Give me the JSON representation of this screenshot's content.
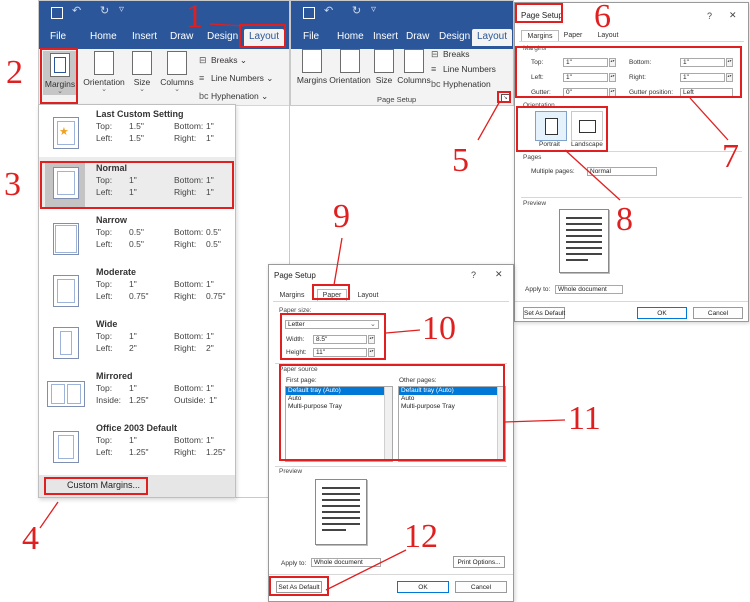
{
  "word_left": {
    "tabs": [
      "File",
      "Home",
      "Insert",
      "Draw",
      "Design",
      "Layout"
    ],
    "buttons": {
      "margins": "Margins",
      "orientation": "Orientation",
      "size": "Size",
      "columns": "Columns"
    },
    "small": {
      "breaks": "Breaks",
      "line_numbers": "Line Numbers",
      "hyphenation": "Hyphenation"
    }
  },
  "margins_menu": {
    "items": [
      {
        "name": "Last Custom Setting",
        "r1": [
          "Top:",
          "1.5\"",
          "Bottom:",
          "1\""
        ],
        "r2": [
          "Left:",
          "1.5\"",
          "Right:",
          "1\""
        ]
      },
      {
        "name": "Normal",
        "r1": [
          "Top:",
          "1\"",
          "Bottom:",
          "1\""
        ],
        "r2": [
          "Left:",
          "1\"",
          "Right:",
          "1\""
        ]
      },
      {
        "name": "Narrow",
        "r1": [
          "Top:",
          "0.5\"",
          "Bottom:",
          "0.5\""
        ],
        "r2": [
          "Left:",
          "0.5\"",
          "Right:",
          "0.5\""
        ]
      },
      {
        "name": "Moderate",
        "r1": [
          "Top:",
          "1\"",
          "Bottom:",
          "1\""
        ],
        "r2": [
          "Left:",
          "0.75\"",
          "Right:",
          "0.75\""
        ]
      },
      {
        "name": "Wide",
        "r1": [
          "Top:",
          "1\"",
          "Bottom:",
          "1\""
        ],
        "r2": [
          "Left:",
          "2\"",
          "Right:",
          "2\""
        ]
      },
      {
        "name": "Mirrored",
        "r1": [
          "Top:",
          "1\"",
          "Bottom:",
          "1\""
        ],
        "r2": [
          "Inside:",
          "1.25\"",
          "Outside:",
          "1\""
        ]
      },
      {
        "name": "Office 2003 Default",
        "r1": [
          "Top:",
          "1\"",
          "Bottom:",
          "1\""
        ],
        "r2": [
          "Left:",
          "1.25\"",
          "Right:",
          "1.25\""
        ]
      }
    ],
    "custom": "Custom Margins..."
  },
  "word_right": {
    "tabs": [
      "File",
      "Home",
      "Insert",
      "Draw",
      "Design",
      "Layout"
    ],
    "buttons": {
      "margins": "Margins",
      "orientation": "Orientation",
      "size": "Size",
      "columns": "Columns"
    },
    "small": {
      "breaks": "Breaks",
      "line_numbers": "Line Numbers",
      "hyphenation": "Hyphenation"
    },
    "group_label": "Page Setup"
  },
  "dialog_margins": {
    "title": "Page Setup",
    "help": "?",
    "close": "✕",
    "tabs": [
      "Margins",
      "Paper",
      "Layout"
    ],
    "section_margins": "Margins",
    "fields": {
      "top": {
        "label": "Top:",
        "value": "1\""
      },
      "bottom": {
        "label": "Bottom:",
        "value": "1\""
      },
      "left": {
        "label": "Left:",
        "value": "1\""
      },
      "right": {
        "label": "Right:",
        "value": "1\""
      },
      "gutter": {
        "label": "Gutter:",
        "value": "0\""
      },
      "gutter_pos": {
        "label": "Gutter position:",
        "value": "Left"
      }
    },
    "section_orientation": "Orientation",
    "portrait": "Portrait",
    "landscape": "Landscape",
    "section_pages": "Pages",
    "multiple_pages": {
      "label": "Multiple pages:",
      "value": "Normal"
    },
    "section_preview": "Preview",
    "apply_to": {
      "label": "Apply to:",
      "value": "Whole document"
    },
    "set_default": "Set As Default",
    "ok": "OK",
    "cancel": "Cancel"
  },
  "dialog_paper": {
    "title": "Page Setup",
    "help": "?",
    "close": "✕",
    "tabs": [
      "Margins",
      "Paper",
      "Layout"
    ],
    "section_size": "Paper size:",
    "size_value": "Letter",
    "width": {
      "label": "Width:",
      "value": "8.5\""
    },
    "height": {
      "label": "Height:",
      "value": "11\""
    },
    "section_source": "Paper source",
    "first_page": {
      "label": "First page:",
      "options": [
        "Default tray (Auto)",
        "Auto",
        "Multi-purpose Tray"
      ]
    },
    "other_pages": {
      "label": "Other pages:",
      "options": [
        "Default tray (Auto)",
        "Auto",
        "Multi-purpose Tray"
      ]
    },
    "section_preview": "Preview",
    "apply_to": {
      "label": "Apply to:",
      "value": "Whole document"
    },
    "print_options": "Print Options...",
    "set_default": "Set As Default",
    "ok": "OK",
    "cancel": "Cancel"
  },
  "annotations": {
    "n1": "1",
    "n2": "2",
    "n3": "3",
    "n4": "4",
    "n5": "5",
    "n6": "6",
    "n7": "7",
    "n8": "8",
    "n9": "9",
    "n10": "10",
    "n11": "11",
    "n12": "12"
  },
  "colors": {
    "word_blue": "#2b579a",
    "annotation_red": "#e02020",
    "list_select": "#0078d7"
  }
}
